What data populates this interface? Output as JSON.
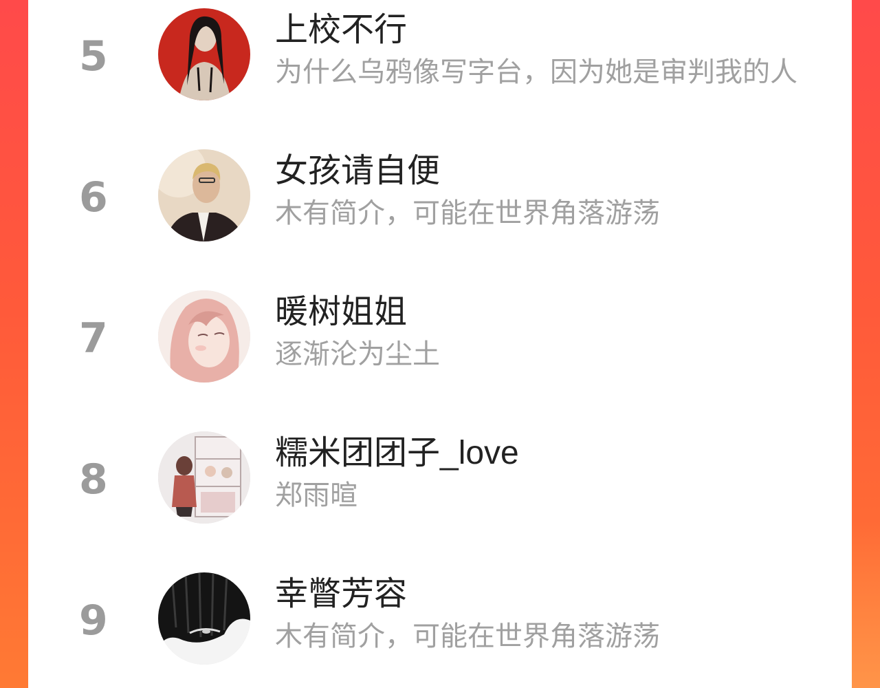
{
  "colors": {
    "accent": "#ff5a3a",
    "rank": "#9b9b9b",
    "name": "#222222",
    "bio": "#a0a0a0"
  },
  "users": [
    {
      "rank": "5",
      "name": "上校不行",
      "bio": "为什么乌鸦像写字台，因为她是审判我的人",
      "avatar_icon": "avatar-image"
    },
    {
      "rank": "6",
      "name": "女孩请自便",
      "bio": "木有简介，可能在世界角落游荡",
      "avatar_icon": "avatar-image"
    },
    {
      "rank": "7",
      "name": "暖树姐姐",
      "bio": "逐渐沦为尘土",
      "avatar_icon": "avatar-image"
    },
    {
      "rank": "8",
      "name": "糯米团团子_love",
      "bio": "郑雨暄",
      "avatar_icon": "avatar-image"
    },
    {
      "rank": "9",
      "name": "幸瞥芳容",
      "bio": "木有简介，可能在世界角落游荡",
      "avatar_icon": "avatar-image"
    }
  ]
}
